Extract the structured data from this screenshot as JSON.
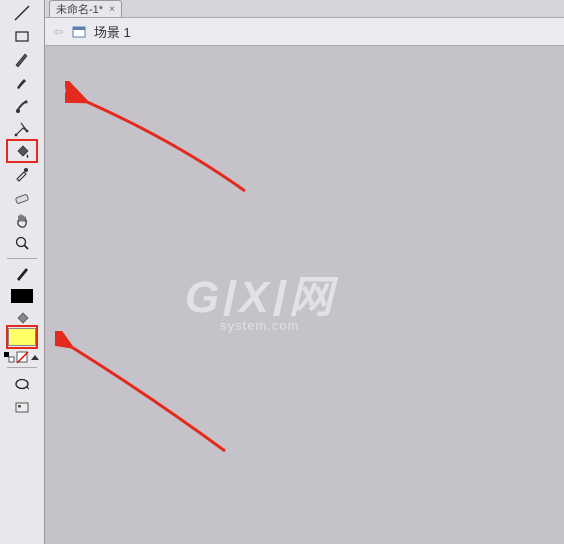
{
  "tab": {
    "label": "未命名-1*",
    "close": "×"
  },
  "breadcrumb": {
    "back": "⇦",
    "scene": "场景 1"
  },
  "toolbar": {
    "tools": [
      "line-tool",
      "rectangle-tool",
      "pencil-tool",
      "brush-tool",
      "decorate-brush-tool",
      "bone-tool",
      "paint-bucket-tool",
      "eyedropper-tool",
      "eraser-tool",
      "hand-tool",
      "zoom-tool"
    ],
    "stroke_tool": "pen-tool",
    "fill_tool": "fill-swatch",
    "option_tool": "options-group",
    "bottom_tool": "snap-tool"
  },
  "watermark": {
    "line1_a": "G",
    "line1_b": "X",
    "line1_c": "网",
    "line2": "system.com"
  },
  "colors": {
    "highlight": "#e42a1d",
    "fill_swatch": "#ffff66"
  }
}
